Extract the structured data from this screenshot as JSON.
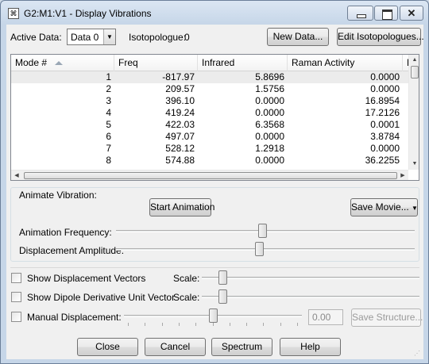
{
  "window": {
    "title": "G2:M1:V1 - Display Vibrations",
    "icon": "gaussview-app-icon"
  },
  "controls": {
    "minimize": "minimize-icon",
    "maximize": "maximize-icon",
    "close": "✕"
  },
  "top": {
    "active_data_label": "Active Data:",
    "active_data_value": "Data 0",
    "isotopologue_label": "Isotopologue:",
    "isotopologue_value": "0",
    "new_data_button": "New Data...",
    "edit_isotopologues_button": "Edit Isotopologues..."
  },
  "table": {
    "columns": [
      "Mode #",
      "Freq",
      "Infrared",
      "Raman Activity",
      "D"
    ],
    "sort_column": "Mode #",
    "selected_row": 1,
    "rows": [
      [
        "1",
        "-817.97",
        "5.8696",
        "0.0000"
      ],
      [
        "2",
        "209.57",
        "1.5756",
        "0.0000"
      ],
      [
        "3",
        "396.10",
        "0.0000",
        "16.8954"
      ],
      [
        "4",
        "419.24",
        "0.0000",
        "17.2126"
      ],
      [
        "5",
        "422.03",
        "6.3568",
        "0.0001"
      ],
      [
        "6",
        "497.07",
        "0.0000",
        "3.8784"
      ],
      [
        "7",
        "528.12",
        "1.2918",
        "0.0000"
      ],
      [
        "8",
        "574.88",
        "0.0000",
        "36.2255"
      ]
    ]
  },
  "animate": {
    "group_label": "Animate Vibration:",
    "start_button": "Start Animation",
    "save_movie_button": "Save Movie...",
    "frequency_label": "Animation Frequency:",
    "frequency_level": 0.49,
    "amplitude_label": "Displacement Amplitude:",
    "amplitude_level": 0.48
  },
  "options": {
    "displacement_vectors_label": "Show Displacement Vectors",
    "displacement_vectors_checked": false,
    "dipole_vector_label": "Show Dipole Derivative Unit Vector",
    "dipole_vector_checked": false,
    "scale_label": "Scale:",
    "scale1_level": 0.08,
    "scale2_level": 0.08,
    "manual_label": "Manual Displacement:",
    "manual_checked": false,
    "manual_level": 0.5,
    "manual_value": "0.00",
    "save_structure_button": "Save Structure..."
  },
  "footer": {
    "close_button": "Close",
    "cancel_button": "Cancel",
    "spectrum_button": "Spectrum",
    "help_button": "Help"
  }
}
